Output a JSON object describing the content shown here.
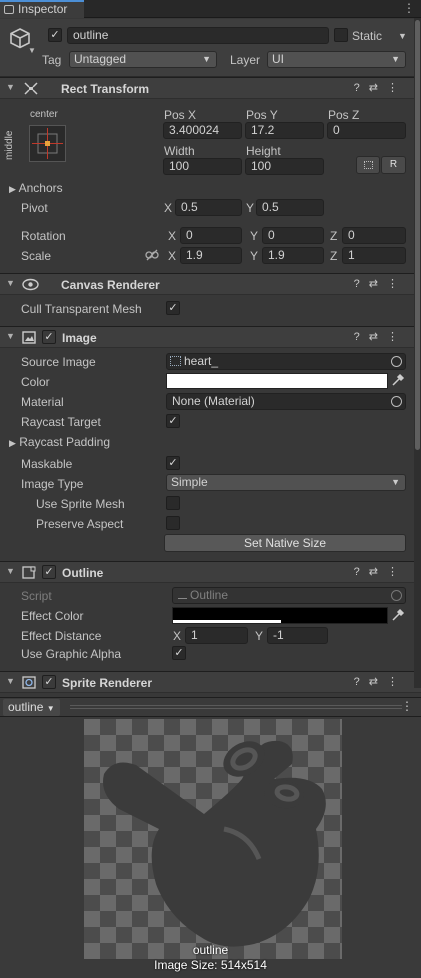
{
  "tab": {
    "title": "Inspector",
    "menu_icon": "kebab-icon"
  },
  "gameobject": {
    "name": "outline",
    "active": true,
    "static_label": "Static",
    "static_checked": false,
    "tag_label": "Tag",
    "tag_value": "Untagged",
    "layer_label": "Layer",
    "layer_value": "UI"
  },
  "rect_transform": {
    "title": "Rect Transform",
    "anchor_top": "center",
    "anchor_side": "middle",
    "col_labels": [
      "Pos X",
      "Pos Y",
      "Pos Z"
    ],
    "pos": [
      "3.400024",
      "17.2",
      "0"
    ],
    "width_label": "Width",
    "height_label": "Height",
    "width": "100",
    "height": "100",
    "r_button": "R",
    "anchors_label": "Anchors",
    "pivot_label": "Pivot",
    "pivot": {
      "x": "0.5",
      "y": "0.5"
    },
    "rotation_label": "Rotation",
    "rotation": {
      "x": "0",
      "y": "0",
      "z": "0"
    },
    "scale_label": "Scale",
    "scale": {
      "x": "1.9",
      "y": "1.9",
      "z": "1"
    },
    "axis": {
      "x": "X",
      "y": "Y",
      "z": "Z"
    }
  },
  "canvas_renderer": {
    "title": "Canvas Renderer",
    "cull_label": "Cull Transparent Mesh",
    "cull_checked": true
  },
  "image": {
    "title": "Image",
    "enabled": true,
    "source_label": "Source Image",
    "source_value": "heart_",
    "color_label": "Color",
    "color_value": "#ffffff",
    "material_label": "Material",
    "material_value": "None (Material)",
    "raycast_target_label": "Raycast Target",
    "raycast_target_checked": true,
    "raycast_padding_label": "Raycast Padding",
    "maskable_label": "Maskable",
    "maskable_checked": true,
    "image_type_label": "Image Type",
    "image_type_value": "Simple",
    "use_sprite_mesh_label": "Use Sprite Mesh",
    "use_sprite_mesh_checked": false,
    "preserve_aspect_label": "Preserve Aspect",
    "preserve_aspect_checked": false,
    "native_size_button": "Set Native Size"
  },
  "outline": {
    "title": "Outline",
    "enabled": true,
    "script_label": "Script",
    "script_value": "Outline",
    "effect_color_label": "Effect Color",
    "effect_color_value": "#000000",
    "effect_distance_label": "Effect Distance",
    "distance": {
      "x": "1",
      "y": "-1"
    },
    "use_alpha_label": "Use Graphic Alpha",
    "use_alpha_checked": true
  },
  "sprite_renderer": {
    "title": "Sprite Renderer",
    "enabled": true
  },
  "preview": {
    "dropdown": "outline",
    "name": "outline",
    "size_text": "Image Size: 514x514"
  },
  "colors": {
    "accent": "#4c8fd6",
    "panel": "#383838",
    "header": "#3e3e3e",
    "field": "#2a2a2a"
  }
}
